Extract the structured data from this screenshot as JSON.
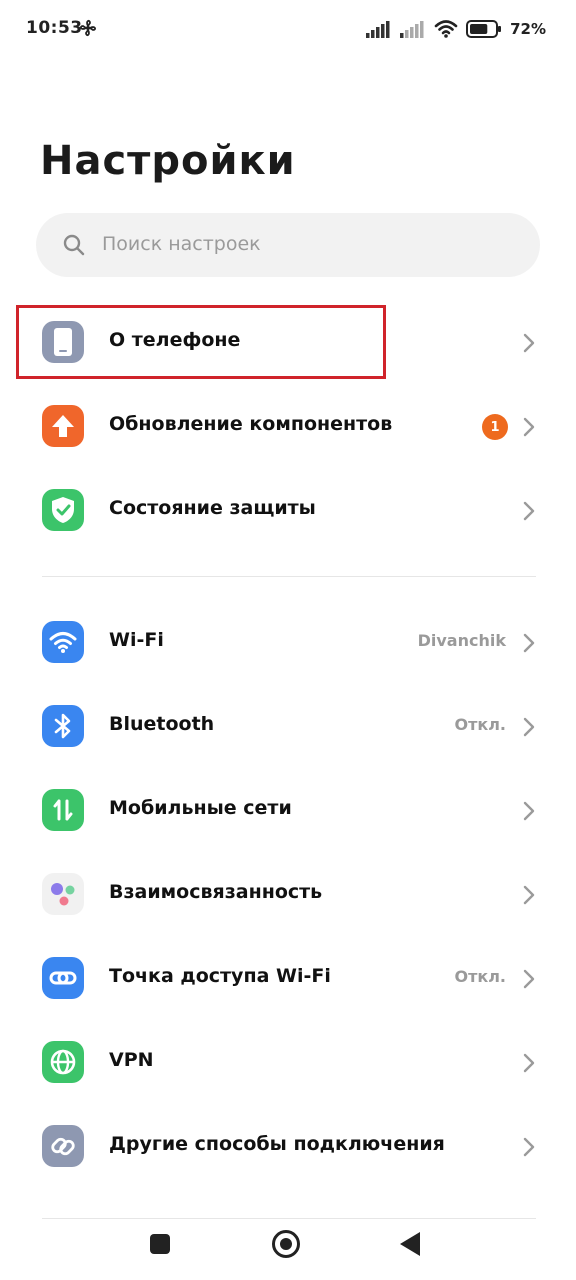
{
  "status": {
    "time": "10:53",
    "battery_percent": "72%",
    "battery_level": 0.72
  },
  "title": "Настройки",
  "search": {
    "placeholder": "Поиск настроек"
  },
  "colors": {
    "accent_highlight": "#d0232a",
    "badge": "#ee6a1e"
  },
  "sections": [
    {
      "items": [
        {
          "label": "О телефоне",
          "icon": "phone-icon",
          "color": "#8e98b1",
          "value": "",
          "highlighted": true
        },
        {
          "label": "Обновление компонентов",
          "icon": "update-arrow-icon",
          "color": "#f0662b",
          "badge": "1"
        },
        {
          "label": "Состояние защиты",
          "icon": "shield-check-icon",
          "color": "#3cc46a"
        }
      ]
    },
    {
      "items": [
        {
          "label": "Wi-Fi",
          "icon": "wifi-icon",
          "color": "#3a86f0",
          "value": "Divanchik"
        },
        {
          "label": "Bluetooth",
          "icon": "bluetooth-icon",
          "color": "#3a86f0",
          "value": "Откл."
        },
        {
          "label": "Мобильные сети",
          "icon": "mobile-data-icon",
          "color": "#3cc46a"
        },
        {
          "label": "Взаимосвязанность",
          "icon": "interconnect-icon",
          "color": "#f1f1f1"
        },
        {
          "label": "Точка доступа Wi-Fi",
          "icon": "hotspot-icon",
          "color": "#3a86f0",
          "value": "Откл."
        },
        {
          "label": "VPN",
          "icon": "globe-icon",
          "color": "#3cc46a"
        },
        {
          "label": "Другие способы подключения",
          "icon": "link-icon",
          "color": "#8e98b1"
        }
      ]
    }
  ]
}
